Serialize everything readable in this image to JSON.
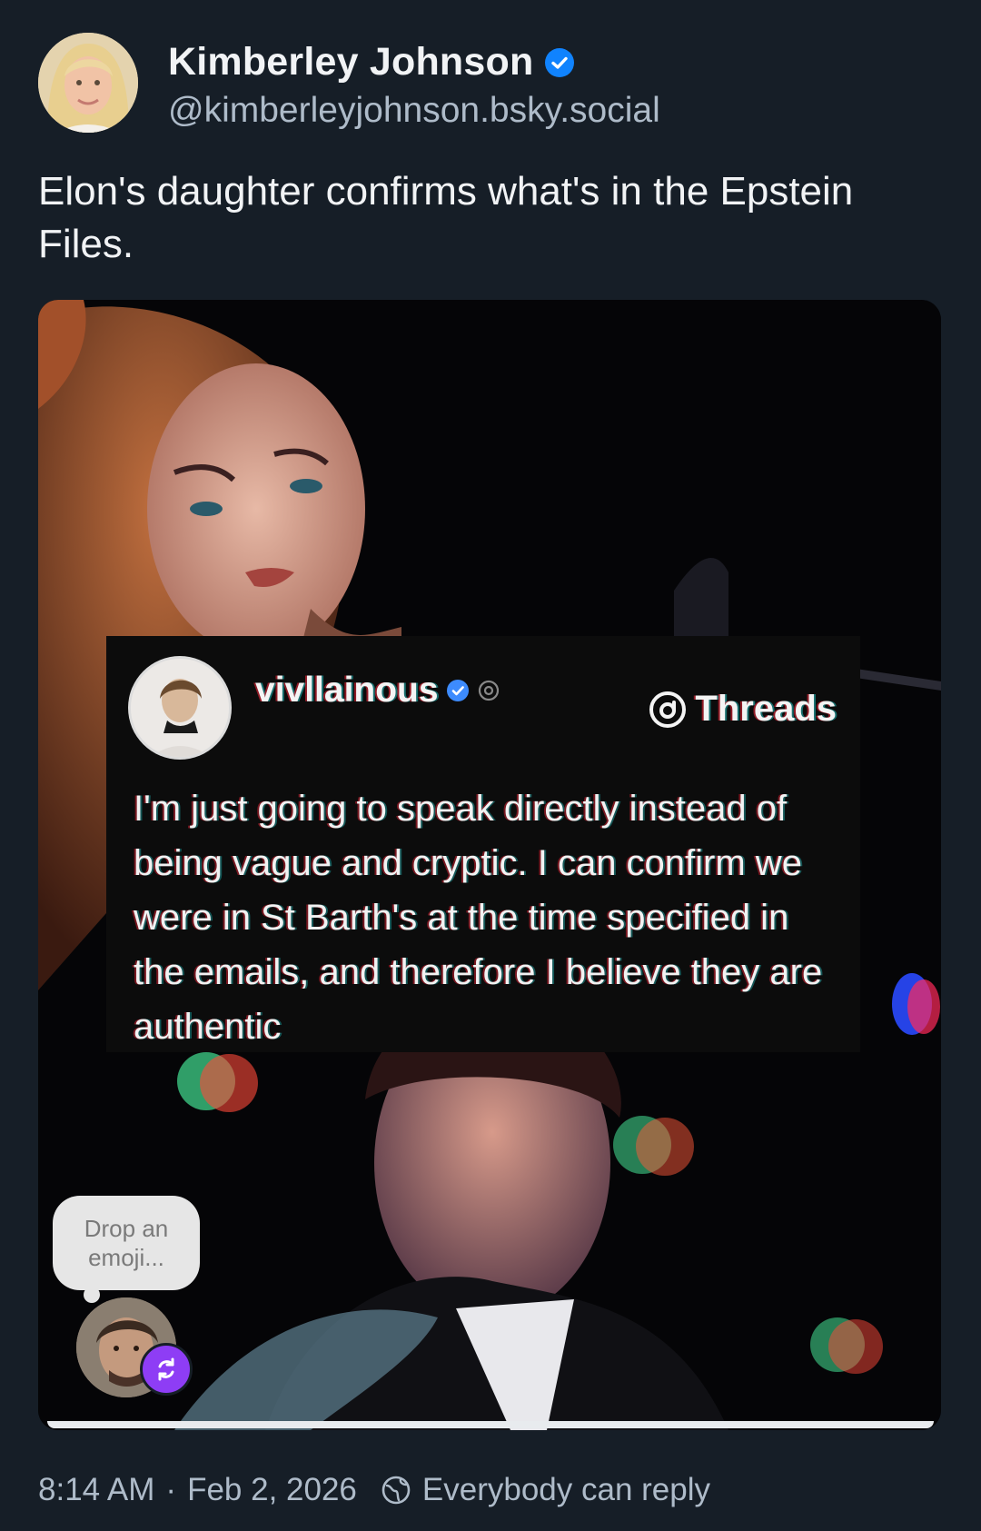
{
  "author": {
    "display_name": "Kimberley Johnson",
    "handle": "@kimberleyjohnson.bsky.social",
    "verified": true
  },
  "post": {
    "text": "Elon's daughter confirms what's in the Epstein Files."
  },
  "embedded_image": {
    "threads_post": {
      "username": "vivllainous",
      "brand": "Threads",
      "body": "I'm just going to speak directly instead of being vague and cryptic. I can confirm we were in St Barth's at the time specified in the emails, and therefore I believe they are authentic"
    },
    "emoji_prompt": "Drop an emoji..."
  },
  "footer": {
    "time": "8:14 AM",
    "separator": "·",
    "date": "Feb 2, 2026",
    "reply_setting": "Everybody can reply"
  },
  "colors": {
    "background": "#161e27",
    "text_primary": "#f1f3f5",
    "text_secondary": "#aebbc9",
    "verified_blue": "#1083fe",
    "repost_purple": "#8e3df5"
  }
}
